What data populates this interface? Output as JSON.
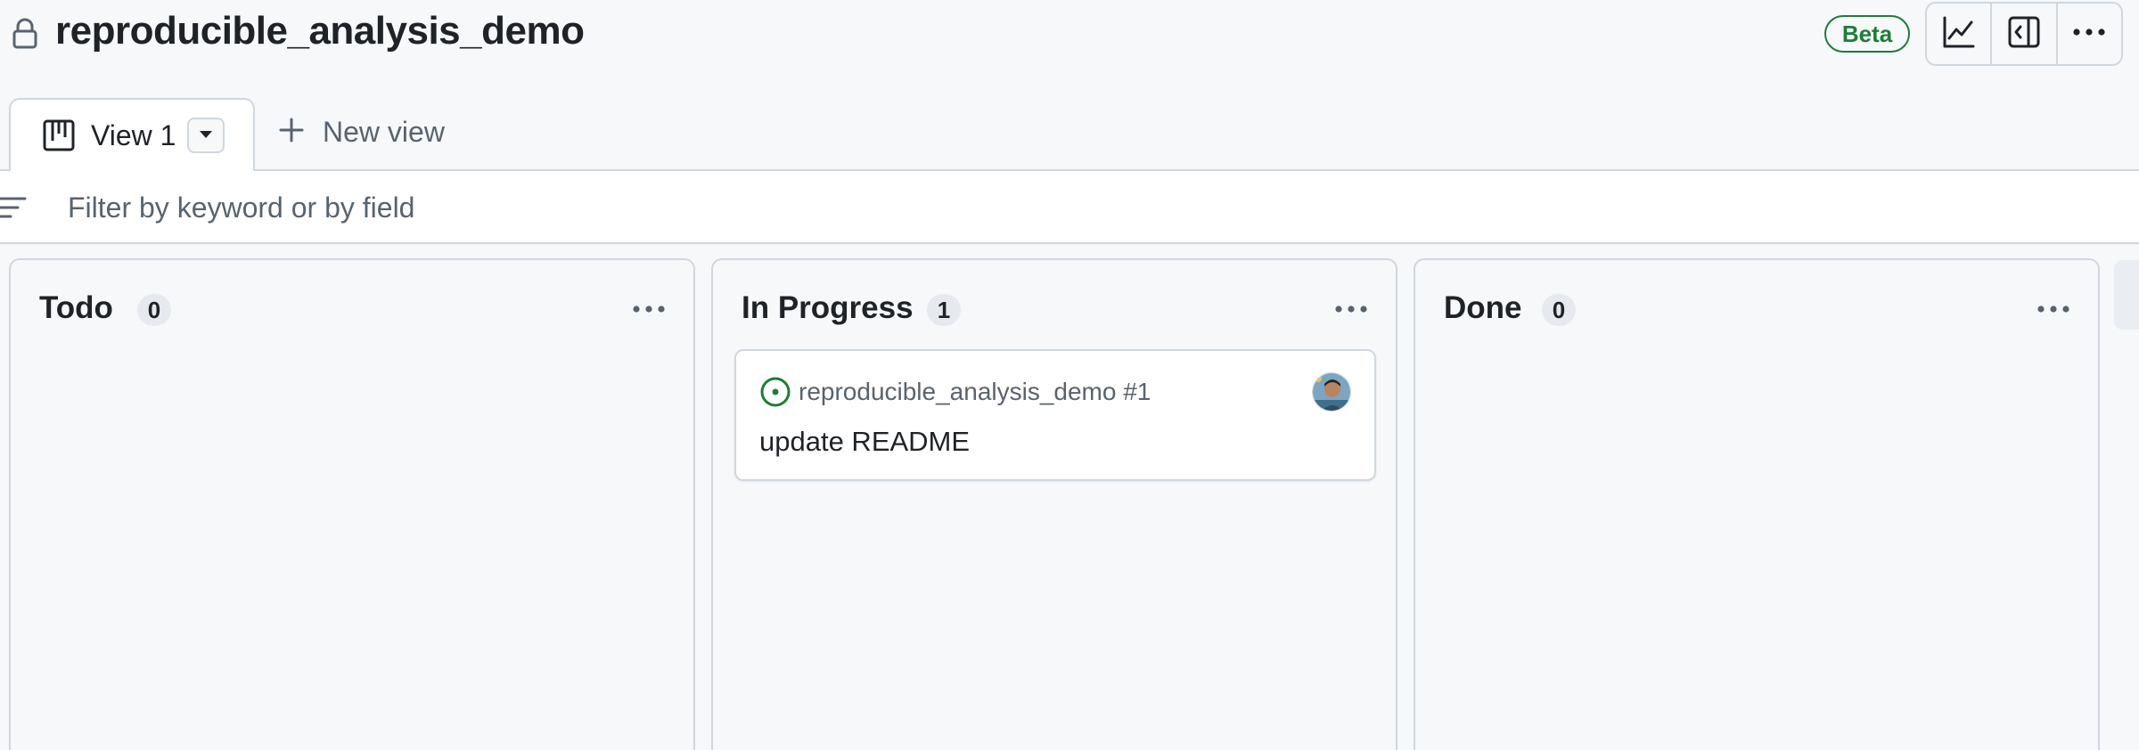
{
  "header": {
    "title": "reproducible_analysis_demo",
    "badge": "Beta",
    "lock_icon": "lock-icon",
    "actions": [
      {
        "name": "insights-button",
        "icon": "graph-icon"
      },
      {
        "name": "side-panel-button",
        "icon": "sidebar-icon"
      },
      {
        "name": "more-options-button",
        "icon": "kebab-horizontal-icon"
      }
    ]
  },
  "tabs": {
    "views": [
      {
        "label": "View 1",
        "icon": "project-board-icon",
        "active": true
      }
    ],
    "new_view_label": "New view"
  },
  "filter": {
    "placeholder": "Filter by keyword or by field",
    "value": ""
  },
  "board": {
    "columns": [
      {
        "title": "Todo",
        "count": "0",
        "cards": []
      },
      {
        "title": "In Progress",
        "count": "1",
        "cards": [
          {
            "repo": "reproducible_analysis_demo #1",
            "title": "update README",
            "status_icon": "issue-open-icon",
            "status_color": "#1a7f37"
          }
        ]
      },
      {
        "title": "Done",
        "count": "0",
        "cards": []
      }
    ]
  },
  "colors": {
    "accent_green": "#1a7f37",
    "border": "#d0d7de",
    "muted_text": "#59636e",
    "background": "#f6f8fa"
  }
}
